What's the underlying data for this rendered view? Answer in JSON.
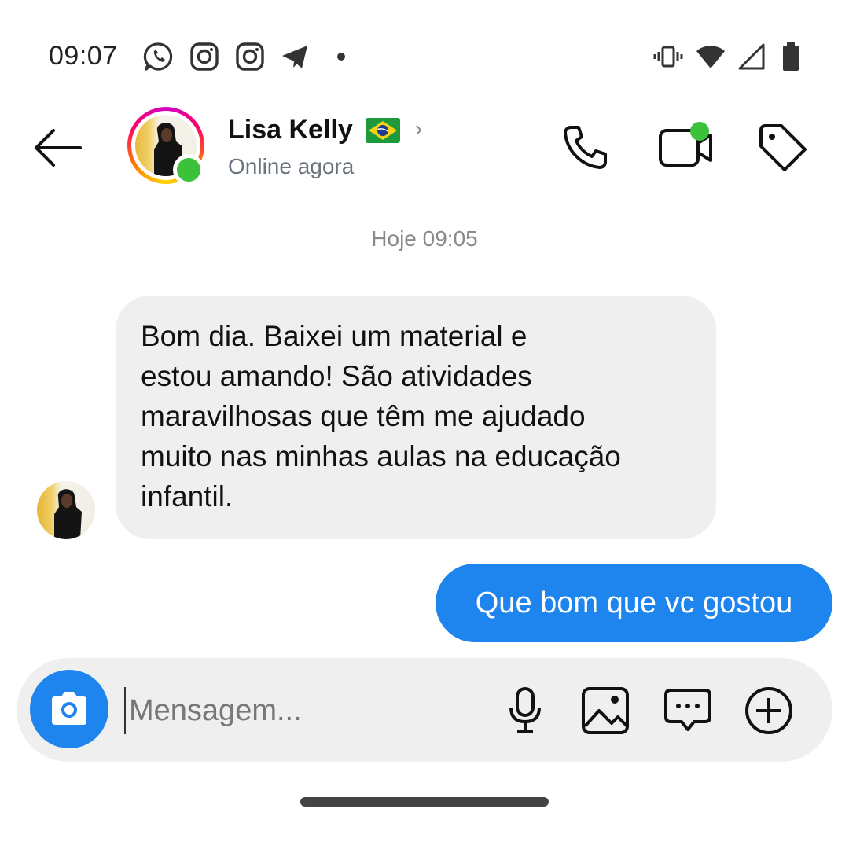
{
  "status_bar": {
    "time": "09:07",
    "left_icons": [
      "whatsapp-icon",
      "instagram-icon",
      "instagram-icon",
      "telegram-icon",
      "dot-icon"
    ],
    "right_icons": [
      "vibrate-icon",
      "wifi-icon",
      "signal-icon",
      "battery-icon"
    ]
  },
  "header": {
    "contact_name": "Lisa Kelly",
    "contact_status": "Online agora",
    "flag": "🇧🇷",
    "actions": [
      "phone-icon",
      "video-call-icon",
      "tag-icon"
    ]
  },
  "conversation": {
    "date_separator": "Hoje 09:05",
    "messages": [
      {
        "direction": "incoming",
        "lines": [
          "Bom dia. Baixei um material e",
          "estou amando! São atividades",
          "maravilhosas que têm me ajudado",
          "muito nas minhas aulas na educação",
          "infantil."
        ]
      },
      {
        "direction": "outgoing",
        "text": "Que bom que vc gostou"
      }
    ]
  },
  "composer": {
    "placeholder": "Mensagem...",
    "value": "",
    "icons": [
      "camera-icon",
      "microphone-icon",
      "gallery-icon",
      "sticker-icon",
      "add-icon"
    ]
  },
  "colors": {
    "accent": "#1e84ee",
    "incoming_bubble": "#efefef",
    "online": "#3cc13b"
  }
}
